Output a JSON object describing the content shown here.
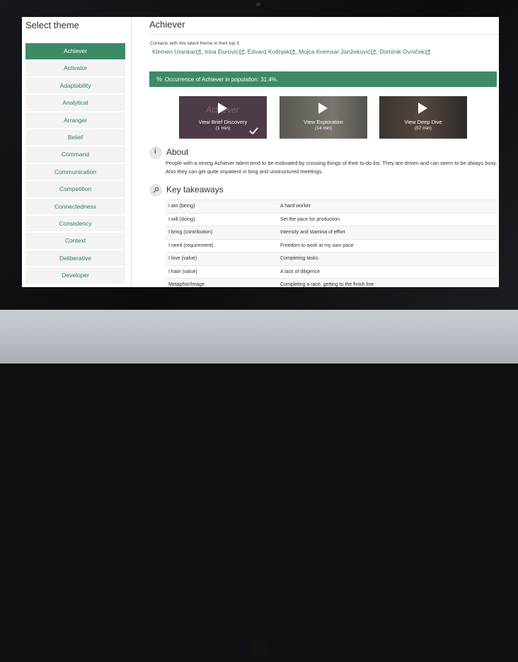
{
  "sidebar": {
    "title": "Select theme",
    "items": [
      "Achiever",
      "Activator",
      "Adaptability",
      "Analytical",
      "Arranger",
      "Belief",
      "Command",
      "Communication",
      "Competition",
      "Connectedness",
      "Consistency",
      "Context",
      "Deliberative",
      "Developer"
    ],
    "active_index": 0
  },
  "main": {
    "title": "Achiever",
    "contacts_label": "Contacts with this talent theme in their top 5",
    "contacts": [
      "Klemen Urankar",
      "Irina Đurović",
      "Edvard Košnjek",
      "Mojca Kremsar Janžeković",
      "Dominik Ovniček"
    ],
    "banner": "Occurrence of Achiever in population: 31.4%.",
    "banner_icon": "%",
    "videos": [
      {
        "label": "View Brief Discovery",
        "duration": "(1 min)",
        "watched": true
      },
      {
        "label": "View Exploration",
        "duration": "(14 min)",
        "watched": false
      },
      {
        "label": "View Deep Dive",
        "duration": "(57 min)",
        "watched": false
      }
    ],
    "video_watermark": "Achiever",
    "about_icon": "i",
    "about_title": "About",
    "about_text": "People with a strong Achiever talent tend to be motivated by crossing things of their to-do list. They are driven and can seem to be always busy. Also they can get quite impatient in long and unstructured meetings.",
    "takeaways_title": "Key takeaways",
    "takeaways": [
      [
        "I am (being)",
        "A hard worker"
      ],
      [
        "I will (doing)",
        "Set the pace for production"
      ],
      [
        "I bring (contribution)",
        "Intensity and stamina of effort"
      ],
      [
        "I need (requirement)",
        "Freedom to work at my own pace"
      ],
      [
        "I love (value)",
        "Completing tasks"
      ],
      [
        "I hate (value)",
        "A lack of diligence"
      ],
      [
        "Metaphor/Image",
        "Completing a race, getting to the finish line"
      ]
    ]
  },
  "colors": {
    "accent": "#3d8a67",
    "link": "#2e7d5b",
    "video1": "#4d3b48",
    "video2": "#6a6762",
    "video3": "#3b3431"
  }
}
